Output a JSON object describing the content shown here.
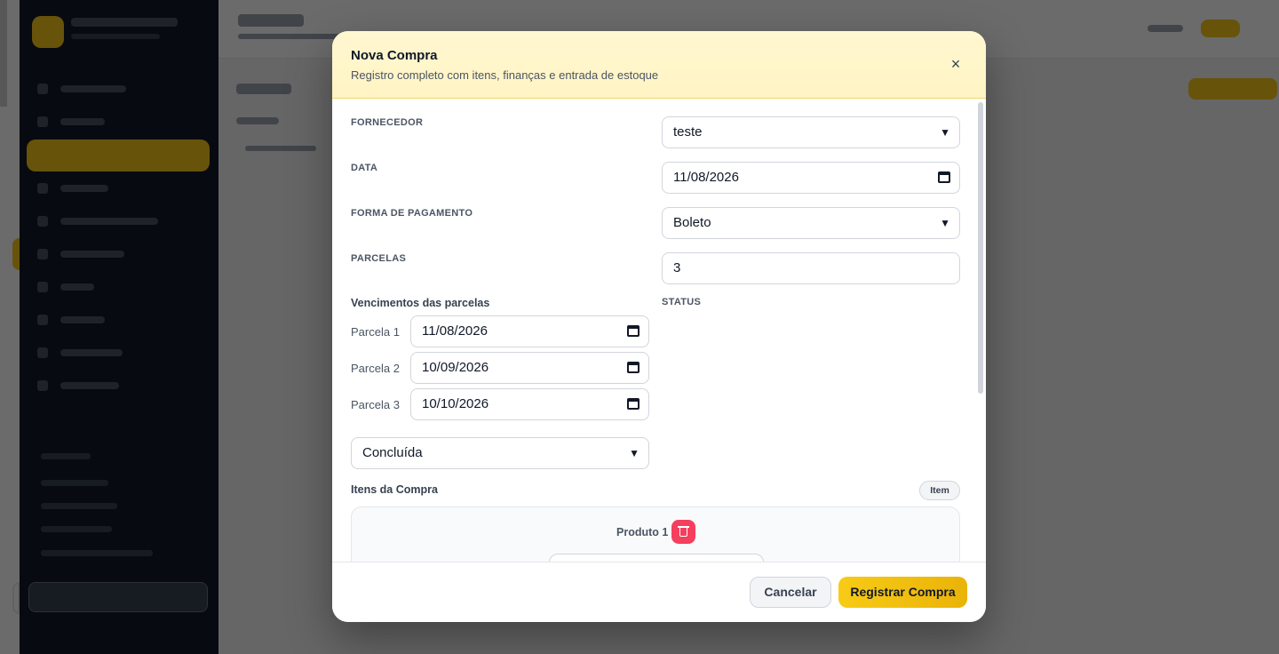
{
  "modal": {
    "title": "Nova Compra",
    "subtitle": "Registro completo com itens, finanças e entrada de estoque",
    "close_icon": "×"
  },
  "form": {
    "fornecedor": {
      "label": "FORNECEDOR",
      "value": "teste"
    },
    "data": {
      "label": "DATA",
      "value": "11/08/2026"
    },
    "forma_pagamento": {
      "label": "FORMA DE PAGAMENTO",
      "value": "Boleto"
    },
    "parcelas": {
      "label": "PARCELAS",
      "value": "3"
    },
    "vencimentos": {
      "title": "Vencimentos das parcelas",
      "items": [
        {
          "label": "Parcela 1",
          "value": "11/08/2026"
        },
        {
          "label": "Parcela 2",
          "value": "10/09/2026"
        },
        {
          "label": "Parcela 3",
          "value": "10/10/2026"
        }
      ]
    },
    "status": {
      "label": "STATUS",
      "value": "Concluída"
    }
  },
  "itens": {
    "title": "Itens da Compra",
    "add_button": "Item",
    "produto_title": "Produto 1"
  },
  "footer": {
    "cancel_label": "Cancelar",
    "save_label": "Registrar Compra"
  },
  "colors": {
    "accent": "#F5C518",
    "header_bg": "#FFF6CC",
    "delete": "#F43F5E",
    "sidebar": "#111827"
  }
}
